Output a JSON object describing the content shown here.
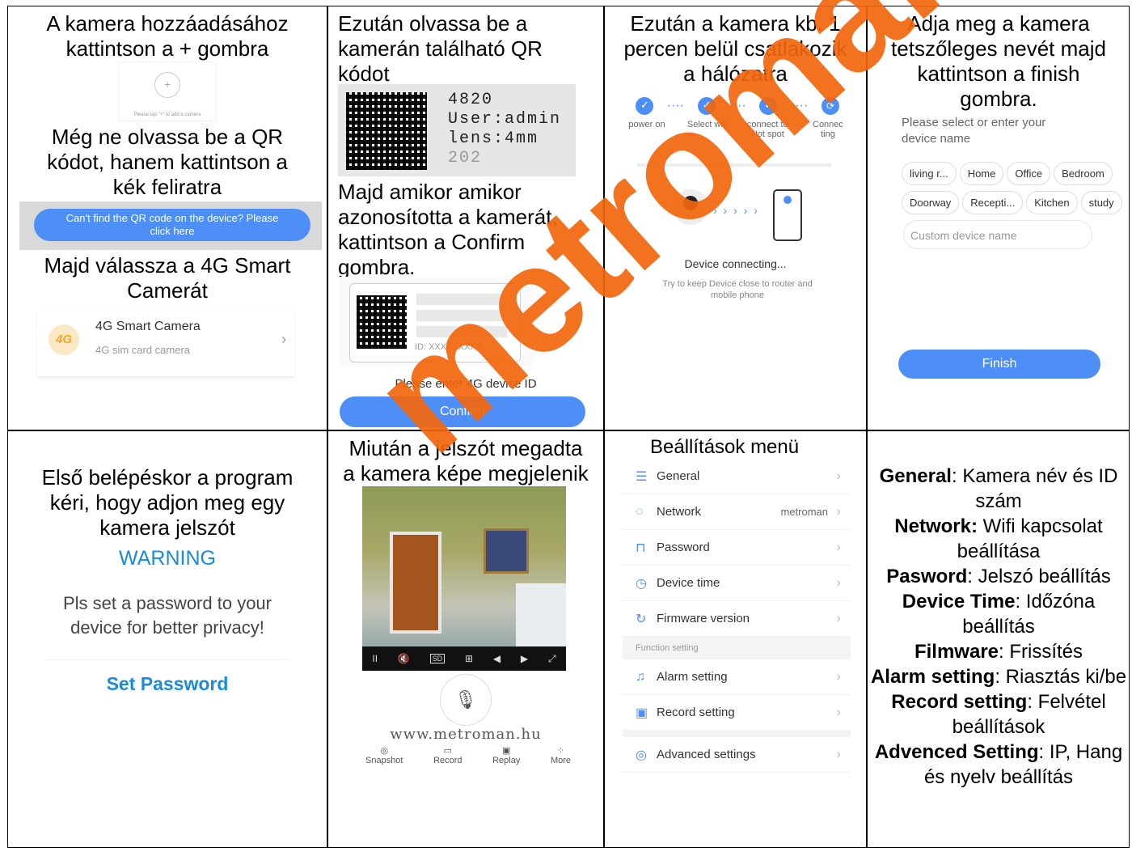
{
  "cell1": {
    "line1": "A kamera hozzáadásához",
    "line2": "kattintson a + gombra",
    "add_hint": "Please tap \"+\" to add a camera",
    "line3": "Még ne olvassa be a QR",
    "line4": "kódot, hanem kattintson a",
    "line5": "kék feliratra",
    "qr_help_btn": "Can't find the QR code on the device? Please",
    "qr_help_btn2": "click here",
    "line6": "Majd válassza a 4G Smart",
    "line7": "Camerát",
    "camera_badge": "4G",
    "camera_title": "4G Smart Camera",
    "camera_sub": "4G sim card camera"
  },
  "cell2": {
    "line1": "Ezután olvassa be a",
    "line2": "kamerán található QR",
    "line3": "kódot",
    "label_id": "4820",
    "label_user": "User:admin",
    "label_lens": "lens:4mm",
    "label_date": "202",
    "line4": "Majd amikor amikor",
    "line5": "azonosította a kamerát,",
    "line6": "kattintson a Confirm",
    "line7": "gombra.",
    "id_placeholder": "ID: XXXXXXXXX",
    "enter_id": "Please enter 4G device ID",
    "confirm": "Confirm"
  },
  "cell3": {
    "line1": "Ezután a kamera kb. 1",
    "line2": "percen belül csatlakozik",
    "line3": "a hálózatra",
    "steps": [
      "power on",
      "Select wifi",
      "connect to Hot spot",
      "Connec ting"
    ],
    "connecting": "Device connecting...",
    "hint": "Try to keep Device close to router and mobile phone"
  },
  "cell4": {
    "line1": "Adja meg a kamera",
    "line2": "tetszőleges nevét majd",
    "line3": "kattintson a finish",
    "line4": "gombra.",
    "prompt": "Please select or enter your device name",
    "chips_row1": [
      "living r...",
      "Home",
      "Office",
      "Bedroom"
    ],
    "chips_row2": [
      "Doorway",
      "Recepti...",
      "Kitchen",
      "study"
    ],
    "custom_placeholder": "Custom device name",
    "finish": "Finish"
  },
  "cell5": {
    "line1": "Első belépéskor a program",
    "line2": "kéri, hogy adjon meg egy",
    "line3": "kamera jelszót",
    "warning": "WARNING",
    "msg1": "Pls set a password to your",
    "msg2": "device for better privacy!",
    "set_password": "Set Password"
  },
  "cell6": {
    "line1": "Miután a jelszót megadta",
    "line2": "a kamera képe megjelenik",
    "controls": [
      "II",
      "🔇",
      "SD",
      "⊞",
      "◀",
      "▶",
      "⤢"
    ],
    "watermark": "www.metroman.hu",
    "actions": [
      "Snapshot",
      "Record",
      "Replay",
      "More"
    ]
  },
  "cell7": {
    "title": "Beállítások menü",
    "items": [
      {
        "label": "General",
        "value": ""
      },
      {
        "label": "Network",
        "value": "metroman"
      },
      {
        "label": "Password",
        "value": ""
      },
      {
        "label": "Device time",
        "value": ""
      },
      {
        "label": "Firmware version",
        "value": ""
      }
    ],
    "section": "Function setting",
    "items2": [
      {
        "label": "Alarm setting"
      },
      {
        "label": "Record setting"
      }
    ],
    "advanced": "Advanced settings"
  },
  "cell8": {
    "general_k": "General",
    "general_v": ": Kamera név és ID szám",
    "network_k": "Network:",
    "network_v": " Wifi kapcsolat beállítása",
    "password_k": "Pasword",
    "password_v": ": Jelszó beállítás",
    "time_k": "Device Time",
    "time_v": ": Időzóna beállítás",
    "fw_k": "Filmware",
    "fw_v": ": Frissítés",
    "alarm_k": "Alarm setting",
    "alarm_v": ": Riasztás ki/be",
    "record_k": "Record setting",
    "record_v": ": Felvétel beállítások",
    "adv_k": "Advenced Setting",
    "adv_v": ": IP, Hang és nyelv beállítás"
  },
  "watermark": "metroman.hu",
  "colors": {
    "accent": "#4e8ef7",
    "watermark": "#f2670e"
  }
}
